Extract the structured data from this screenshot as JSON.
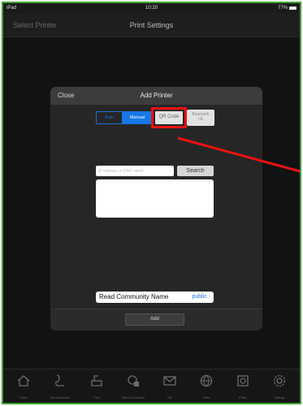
{
  "status_bar": {
    "carrier": "iPad",
    "time": "10:20",
    "battery": "77%"
  },
  "nav": {
    "back_label": "Select Printer",
    "title": "Print Settings"
  },
  "dialog": {
    "close_label": "Close",
    "title": "Add Printer",
    "segments": {
      "auto": "Auto",
      "manual": "Manual",
      "qr": "QR Code",
      "ble_line1": "Bluetooth",
      "ble_line2": "LE"
    },
    "selected_segment": "Manual",
    "ip_input": {
      "placeholder": "IP address or DNS name",
      "value": ""
    },
    "search_label": "Search",
    "community_label": "Read Community Name",
    "community_value": "public",
    "add_label": "Add"
  },
  "annotation": {
    "highlight_color": "#ee1111",
    "highlight_target": "QR Code"
  },
  "tabs": [
    {
      "label": "Home",
      "icon": "home-icon"
    },
    {
      "label": "My Documents",
      "icon": "documents-icon"
    },
    {
      "label": "Print",
      "icon": "print-icon"
    },
    {
      "label": "Web & Document",
      "icon": "web-document-icon"
    },
    {
      "label": "Fax",
      "icon": "envelope-icon"
    },
    {
      "label": "Web",
      "icon": "globe-icon"
    },
    {
      "label": "Photo",
      "icon": "photo-icon"
    },
    {
      "label": "Settings",
      "icon": "gear-icon"
    }
  ],
  "colors": {
    "accent": "#1677e8",
    "highlight": "#ee1111",
    "frame_border": "#3aa02a"
  }
}
